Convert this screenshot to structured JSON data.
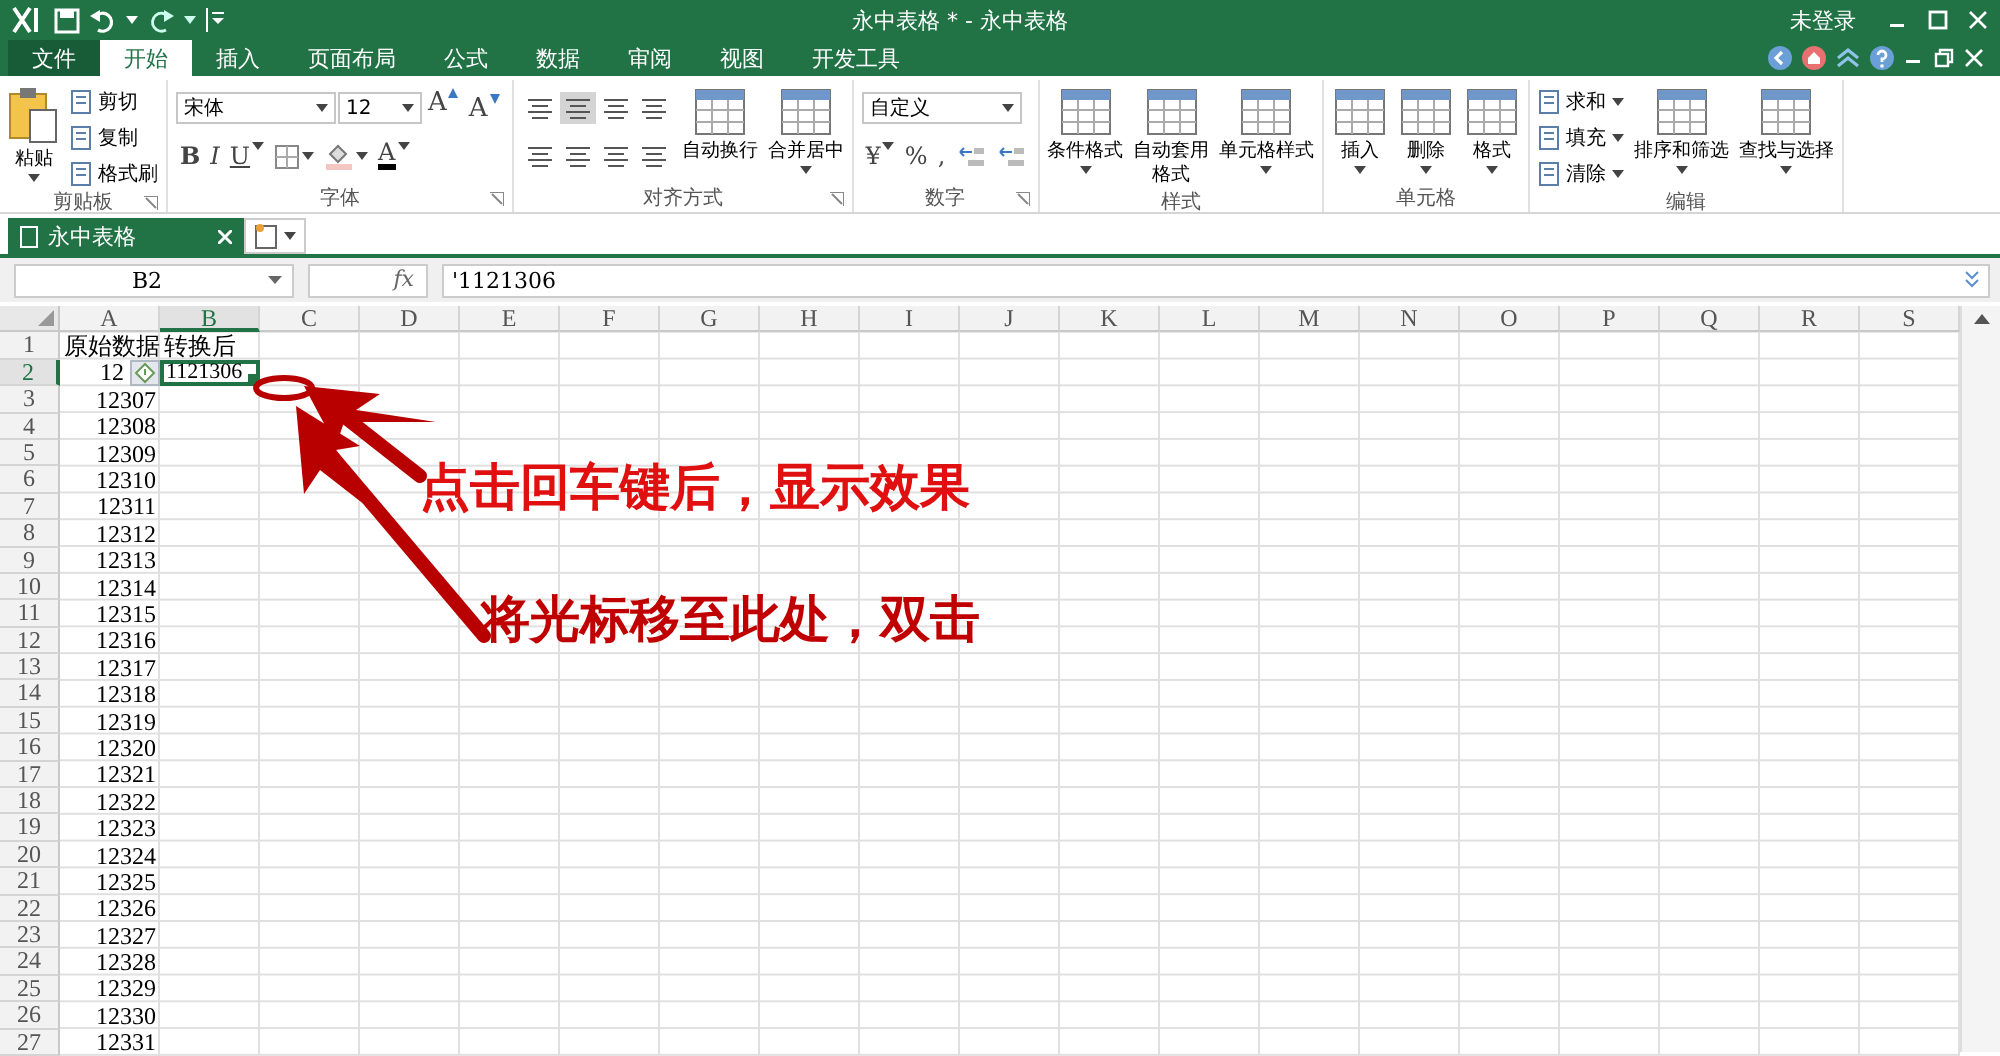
{
  "window": {
    "title": "永中表格 * - 永中表格",
    "user": "未登录"
  },
  "menu_tabs": [
    {
      "label": "文件",
      "kind": "file",
      "selected": false
    },
    {
      "label": "开始",
      "kind": "tab",
      "selected": true
    },
    {
      "label": "插入",
      "kind": "tab",
      "selected": false
    },
    {
      "label": "页面布局",
      "kind": "tab",
      "selected": false
    },
    {
      "label": "公式",
      "kind": "tab",
      "selected": false
    },
    {
      "label": "数据",
      "kind": "tab",
      "selected": false
    },
    {
      "label": "审阅",
      "kind": "tab",
      "selected": false
    },
    {
      "label": "视图",
      "kind": "tab",
      "selected": false
    },
    {
      "label": "开发工具",
      "kind": "tab",
      "selected": false
    }
  ],
  "ribbon": [
    {
      "label": "剪贴板",
      "launcher": true,
      "columns": [
        [
          {
            "kind": "paste",
            "label": "粘贴",
            "caret": true
          }
        ],
        [
          {
            "kind": "small",
            "label": "剪切",
            "caret": false
          },
          {
            "kind": "small",
            "label": "复制",
            "caret": false
          },
          {
            "kind": "small",
            "label": "格式刷",
            "caret": false
          }
        ]
      ]
    },
    {
      "label": "字体",
      "launcher": true,
      "rows": [
        {
          "items": [
            {
              "kind": "select",
              "value": "宋体",
              "wide": true
            },
            {
              "kind": "select",
              "value": "12",
              "wide": false
            },
            {
              "kind": "grow",
              "label": "A",
              "caret": false
            },
            {
              "kind": "shrink",
              "label": "A",
              "caret": false
            }
          ]
        },
        {
          "items": [
            {
              "kind": "bold",
              "label": "B",
              "caret": false
            },
            {
              "kind": "italic",
              "label": "I",
              "caret": false
            },
            {
              "kind": "underline",
              "label": "U",
              "caret": true
            },
            {
              "kind": "border",
              "caret": true
            },
            {
              "kind": "fill",
              "caret": true
            },
            {
              "kind": "fontcolor",
              "label": "A",
              "caret": true
            }
          ]
        }
      ]
    },
    {
      "label": "对齐方式",
      "launcher": true,
      "rows": [
        {
          "items": [
            {
              "kind": "align",
              "selected": false
            },
            {
              "kind": "align",
              "selected": true
            },
            {
              "kind": "align",
              "selected": false
            },
            {
              "kind": "align",
              "selected": false
            }
          ]
        },
        {
          "items": [
            {
              "kind": "align",
              "selected": false
            },
            {
              "kind": "align",
              "selected": false
            },
            {
              "kind": "align",
              "selected": false
            },
            {
              "kind": "align",
              "selected": false
            }
          ]
        }
      ],
      "columns": [
        [
          {
            "kind": "large",
            "label": "自动换行",
            "caret": false
          }
        ],
        [
          {
            "kind": "large",
            "label": "合并居中",
            "caret": true
          }
        ]
      ]
    },
    {
      "label": "数字",
      "launcher": true,
      "rows": [
        {
          "items": [
            {
              "kind": "select",
              "value": "自定义",
              "wide": true
            }
          ]
        },
        {
          "items": [
            {
              "kind": "glyph",
              "label": "¥",
              "caret": true
            },
            {
              "kind": "glyph",
              "label": "%",
              "caret": false
            },
            {
              "kind": "glyph",
              "label": ",",
              "caret": false
            },
            {
              "kind": "decimal"
            },
            {
              "kind": "decimal"
            }
          ]
        }
      ]
    },
    {
      "label": "样式",
      "launcher": false,
      "columns": [
        [
          {
            "kind": "large",
            "label": "条件格式",
            "caret": true
          }
        ],
        [
          {
            "kind": "large",
            "label": "自动套用格式",
            "caret": false,
            "wrap": true
          }
        ],
        [
          {
            "kind": "large",
            "label": "单元格样式",
            "caret": true
          }
        ]
      ]
    },
    {
      "label": "单元格",
      "launcher": false,
      "columns": [
        [
          {
            "kind": "large",
            "label": "插入",
            "caret": true
          }
        ],
        [
          {
            "kind": "large",
            "label": "删除",
            "caret": true
          }
        ],
        [
          {
            "kind": "large",
            "label": "格式",
            "caret": true
          }
        ]
      ]
    },
    {
      "label": "编辑",
      "launcher": false,
      "columns": [
        [
          {
            "kind": "small",
            "label": "求和",
            "caret": true
          },
          {
            "kind": "small",
            "label": "填充",
            "caret": true
          },
          {
            "kind": "small",
            "label": "清除",
            "caret": true
          }
        ],
        [
          {
            "kind": "large",
            "label": "排序和筛选",
            "caret": true
          }
        ],
        [
          {
            "kind": "large",
            "label": "查找与选择",
            "caret": true
          }
        ]
      ]
    }
  ],
  "document_tabs": [
    {
      "label": "永中表格",
      "selected": true
    }
  ],
  "formula_bar": {
    "name_box": "B2",
    "fx": "fx",
    "formula": "'1121306"
  },
  "sheet": {
    "columns": [
      {
        "label": "A",
        "selected": false
      },
      {
        "label": "B",
        "selected": true
      },
      {
        "label": "C",
        "selected": false
      },
      {
        "label": "D",
        "selected": false
      },
      {
        "label": "E",
        "selected": false
      },
      {
        "label": "F",
        "selected": false
      },
      {
        "label": "G",
        "selected": false
      },
      {
        "label": "H",
        "selected": false
      },
      {
        "label": "I",
        "selected": false
      },
      {
        "label": "J",
        "selected": false
      },
      {
        "label": "K",
        "selected": false
      },
      {
        "label": "L",
        "selected": false
      },
      {
        "label": "M",
        "selected": false
      },
      {
        "label": "N",
        "selected": false
      },
      {
        "label": "O",
        "selected": false
      },
      {
        "label": "P",
        "selected": false
      },
      {
        "label": "Q",
        "selected": false
      },
      {
        "label": "R",
        "selected": false
      },
      {
        "label": "S",
        "selected": false
      }
    ],
    "rows": [
      {
        "label": "1",
        "selected": false,
        "cells": [
          {
            "text": "原始数据",
            "kind": "text"
          },
          {
            "text": "转换后",
            "kind": "text"
          }
        ]
      },
      {
        "label": "2",
        "selected": true,
        "cells": [
          {
            "text": "12",
            "kind": "number",
            "flag": true
          },
          {
            "text": "1121306",
            "kind": "text"
          }
        ]
      },
      {
        "label": "3",
        "selected": false,
        "cells": [
          {
            "text": "12307",
            "kind": "number"
          }
        ]
      },
      {
        "label": "4",
        "selected": false,
        "cells": [
          {
            "text": "12308",
            "kind": "number"
          }
        ]
      },
      {
        "label": "5",
        "selected": false,
        "cells": [
          {
            "text": "12309",
            "kind": "number"
          }
        ]
      },
      {
        "label": "6",
        "selected": false,
        "cells": [
          {
            "text": "12310",
            "kind": "number"
          }
        ]
      },
      {
        "label": "7",
        "selected": false,
        "cells": [
          {
            "text": "12311",
            "kind": "number"
          }
        ]
      },
      {
        "label": "8",
        "selected": false,
        "cells": [
          {
            "text": "12312",
            "kind": "number"
          }
        ]
      },
      {
        "label": "9",
        "selected": false,
        "cells": [
          {
            "text": "12313",
            "kind": "number"
          }
        ]
      },
      {
        "label": "10",
        "selected": false,
        "cells": [
          {
            "text": "12314",
            "kind": "number"
          }
        ]
      },
      {
        "label": "11",
        "selected": false,
        "cells": [
          {
            "text": "12315",
            "kind": "number"
          }
        ]
      },
      {
        "label": "12",
        "selected": false,
        "cells": [
          {
            "text": "12316",
            "kind": "number"
          }
        ]
      },
      {
        "label": "13",
        "selected": false,
        "cells": [
          {
            "text": "12317",
            "kind": "number"
          }
        ]
      },
      {
        "label": "14",
        "selected": false,
        "cells": [
          {
            "text": "12318",
            "kind": "number"
          }
        ]
      },
      {
        "label": "15",
        "selected": false,
        "cells": [
          {
            "text": "12319",
            "kind": "number"
          }
        ]
      },
      {
        "label": "16",
        "selected": false,
        "cells": [
          {
            "text": "12320",
            "kind": "number"
          }
        ]
      },
      {
        "label": "17",
        "selected": false,
        "cells": [
          {
            "text": "12321",
            "kind": "number"
          }
        ]
      },
      {
        "label": "18",
        "selected": false,
        "cells": [
          {
            "text": "12322",
            "kind": "number"
          }
        ]
      },
      {
        "label": "19",
        "selected": false,
        "cells": [
          {
            "text": "12323",
            "kind": "number"
          }
        ]
      },
      {
        "label": "20",
        "selected": false,
        "cells": [
          {
            "text": "12324",
            "kind": "number"
          }
        ]
      },
      {
        "label": "21",
        "selected": false,
        "cells": [
          {
            "text": "12325",
            "kind": "number"
          }
        ]
      },
      {
        "label": "22",
        "selected": false,
        "cells": [
          {
            "text": "12326",
            "kind": "number"
          }
        ]
      },
      {
        "label": "23",
        "selected": false,
        "cells": [
          {
            "text": "12327",
            "kind": "number"
          }
        ]
      },
      {
        "label": "24",
        "selected": false,
        "cells": [
          {
            "text": "12328",
            "kind": "number"
          }
        ]
      },
      {
        "label": "25",
        "selected": false,
        "cells": [
          {
            "text": "12329",
            "kind": "number"
          }
        ]
      },
      {
        "label": "26",
        "selected": false,
        "cells": [
          {
            "text": "12330",
            "kind": "number"
          }
        ]
      },
      {
        "label": "27",
        "selected": false,
        "cells": [
          {
            "text": "12331",
            "kind": "number"
          }
        ]
      }
    ]
  },
  "annotations": [
    {
      "text": "点击回车键后，显示效果",
      "color": "#e01010"
    },
    {
      "text": "将光标移至此处，双击",
      "color": "#c00000"
    }
  ]
}
